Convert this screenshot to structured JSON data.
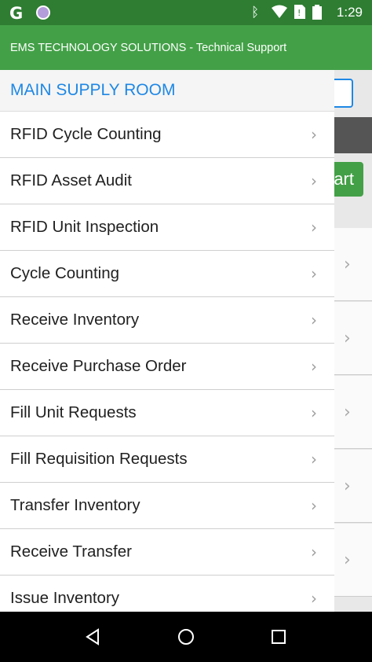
{
  "status_bar": {
    "time": "1:29",
    "icons": [
      "google-g-icon",
      "notification-dot-icon",
      "bluetooth-icon",
      "wifi-icon",
      "no-sim-icon",
      "battery-icon"
    ]
  },
  "drawer": {
    "title": "EMS TECHNOLOGY SOLUTIONS - Technical Support",
    "location": "MAIN SUPPLY ROOM",
    "items": [
      {
        "label": "RFID Cycle Counting"
      },
      {
        "label": "RFID Asset Audit"
      },
      {
        "label": "RFID Unit Inspection"
      },
      {
        "label": "Cycle Counting"
      },
      {
        "label": "Receive Inventory"
      },
      {
        "label": "Receive Purchase Order"
      },
      {
        "label": "Fill Unit Requests"
      },
      {
        "label": "Fill Requisition Requests"
      },
      {
        "label": "Transfer Inventory"
      },
      {
        "label": "Receive Transfer"
      },
      {
        "label": "Issue Inventory"
      }
    ]
  },
  "background_app": {
    "start_button_label_partial": "art"
  },
  "colors": {
    "header_green": "#43a047",
    "status_green": "#2e7d32",
    "location_blue": "#1e88e5"
  }
}
